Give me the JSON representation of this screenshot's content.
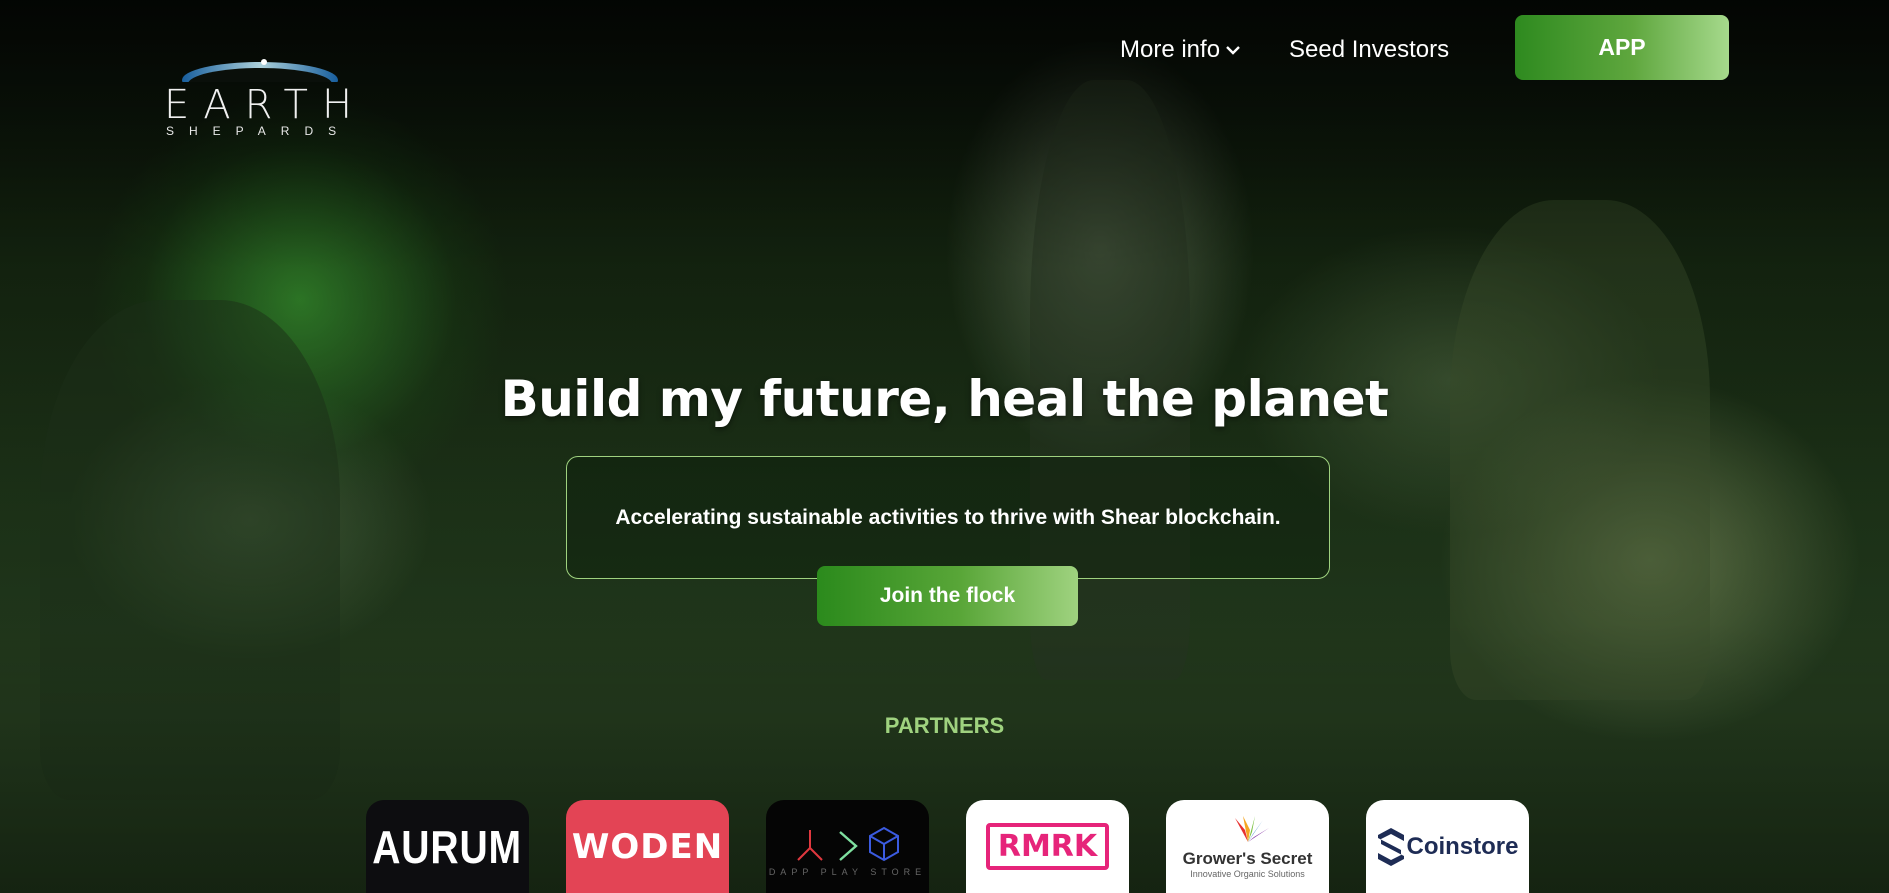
{
  "header": {
    "logo": {
      "word": "EARTH",
      "sub": "SHEPARDS"
    },
    "nav": {
      "more_info": "More info",
      "seed_investors": "Seed Investors",
      "app_button": "APP"
    }
  },
  "hero": {
    "title": "Build my future, heal the planet",
    "tagline": "Accelerating sustainable activities to thrive with Shear blockchain.",
    "cta": "Join the flock"
  },
  "partners": {
    "label": "PARTNERS",
    "items": [
      {
        "name": "AURUM"
      },
      {
        "name": "WODEN"
      },
      {
        "name": "DAPP PLAY STORE"
      },
      {
        "name": "RMRK"
      },
      {
        "name": "Grower's Secret",
        "tagline": "Innovative Organic Solutions"
      },
      {
        "name": "Coinstore"
      }
    ]
  },
  "colors": {
    "accent_green": "#2e8a1f",
    "accent_light": "#9fd27f",
    "woden_red": "#e34455",
    "rmrk_pink": "#e6247a",
    "coinstore_navy": "#1e2c55"
  },
  "icons": [
    "chevron-down-icon",
    "earth-arc-icon"
  ]
}
